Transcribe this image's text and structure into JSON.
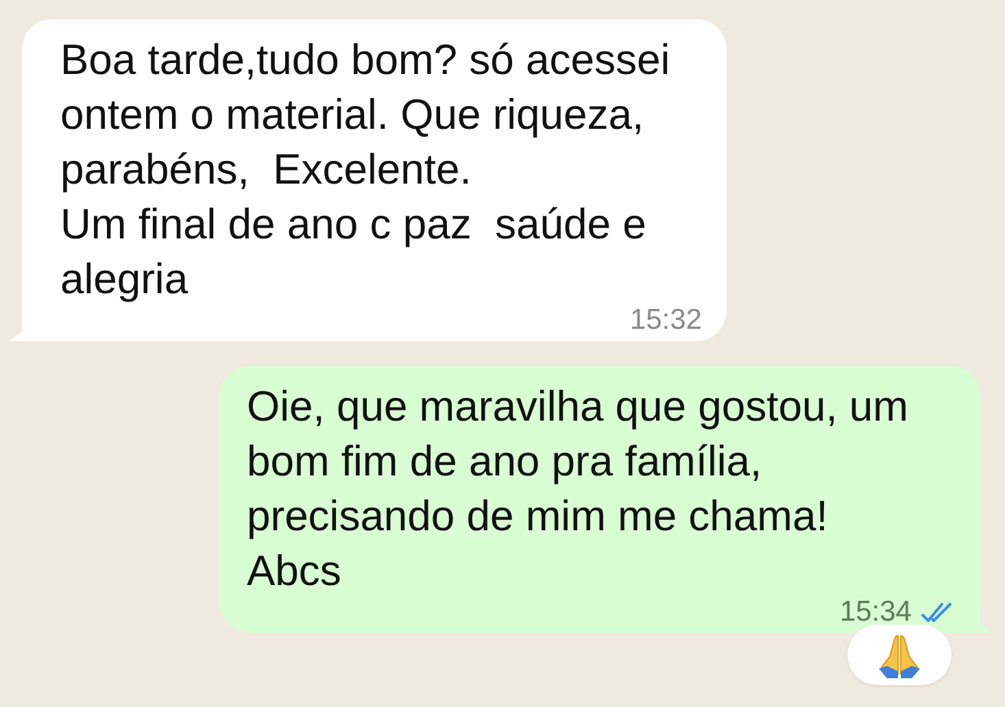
{
  "messages": [
    {
      "kind": "incoming",
      "text": "Boa tarde,tudo bom? só acessei ontem o material. Que riqueza, parabéns,  Excelente.\nUm final de ano c paz  saúde e alegria",
      "time": "15:32",
      "reacted": false
    },
    {
      "kind": "outgoing",
      "text": "Oie, que maravilha que gostou, um bom fim de ano pra família, precisando de mim me chama!\nAbcs",
      "time": "15:34",
      "read": true,
      "reacted": true
    }
  ]
}
